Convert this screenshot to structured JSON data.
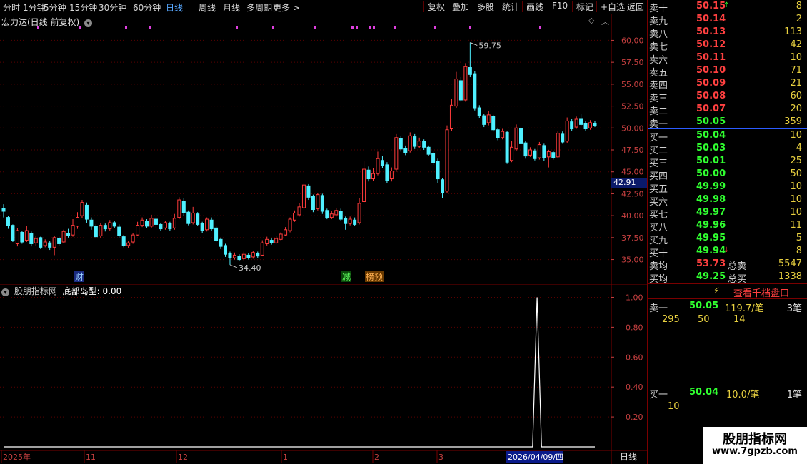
{
  "toolbar": {
    "periods": [
      "分时",
      "1分钟",
      "5分钟",
      "15分钟",
      "30分钟",
      "60分钟",
      "日线",
      "周线",
      "月线",
      "多周期",
      "更多 >"
    ],
    "active_period": "日线",
    "buttons": [
      "复权",
      "叠加",
      "多股",
      "统计",
      "画线",
      "F10",
      "标记",
      "+自选",
      "返回"
    ]
  },
  "main": {
    "stock_title": "宏力达(日线 前复权)",
    "high_label": "59.75",
    "low_label": "34.40",
    "cursor_price": "42.91",
    "markers": {
      "cai": "财",
      "jian": "减",
      "bang": "榜预"
    },
    "y_ticks": [
      "60.00",
      "57.50",
      "55.00",
      "52.50",
      "50.00",
      "47.50",
      "45.00",
      "42.50",
      "40.00",
      "37.50",
      "35.00"
    ]
  },
  "indicator": {
    "name": "股朋指标网",
    "series_label": "底部岛型: 0.00",
    "y_ticks": [
      "1.00",
      "0.80",
      "0.60",
      "0.40",
      "0.20"
    ]
  },
  "xaxis": {
    "labels": [
      "2025年",
      "11",
      "12",
      "1",
      "2",
      "3"
    ],
    "cursor_date": "2026/04/09/四",
    "period_label": "日线"
  },
  "orderbook": {
    "asks": [
      {
        "label": "卖十",
        "price": "50.15",
        "vol": "8"
      },
      {
        "label": "卖九",
        "price": "50.14",
        "vol": "2"
      },
      {
        "label": "卖八",
        "price": "50.13",
        "vol": "113"
      },
      {
        "label": "卖七",
        "price": "50.12",
        "vol": "42"
      },
      {
        "label": "卖六",
        "price": "50.11",
        "vol": "10"
      },
      {
        "label": "卖五",
        "price": "50.10",
        "vol": "71"
      },
      {
        "label": "卖四",
        "price": "50.09",
        "vol": "21"
      },
      {
        "label": "卖三",
        "price": "50.08",
        "vol": "60"
      },
      {
        "label": "卖二",
        "price": "50.07",
        "vol": "20"
      },
      {
        "label": "卖一",
        "price": "50.05",
        "vol": "359"
      }
    ],
    "bids": [
      {
        "label": "买一",
        "price": "50.04",
        "vol": "10"
      },
      {
        "label": "买二",
        "price": "50.03",
        "vol": "4"
      },
      {
        "label": "买三",
        "price": "50.01",
        "vol": "25"
      },
      {
        "label": "买四",
        "price": "50.00",
        "vol": "50"
      },
      {
        "label": "买五",
        "price": "49.99",
        "vol": "10"
      },
      {
        "label": "买六",
        "price": "49.98",
        "vol": "10"
      },
      {
        "label": "买七",
        "price": "49.97",
        "vol": "10"
      },
      {
        "label": "买八",
        "price": "49.96",
        "vol": "11"
      },
      {
        "label": "买九",
        "price": "49.95",
        "vol": "5"
      },
      {
        "label": "买十",
        "price": "49.94",
        "vol": "8"
      }
    ],
    "sell_avg_label": "卖均",
    "sell_avg": "53.73",
    "total_sell_label": "总卖",
    "total_sell": "5547",
    "buy_avg_label": "买均",
    "buy_avg": "49.25",
    "total_buy_label": "总买",
    "total_buy": "1338",
    "depth_link": "查看千档盘口",
    "ask1": {
      "label": "卖一",
      "price": "50.05",
      "qty": "119.7/笔",
      "count": "3笔",
      "d1": "295",
      "d2": "50",
      "d3": "14"
    },
    "bid1": {
      "label": "买一",
      "price": "50.04",
      "qty": "10.0/笔",
      "count": "1笔",
      "d1": "10"
    }
  },
  "watermark": {
    "title": "股朋指标网",
    "url": "www.7gpzb.com"
  },
  "colors": {
    "up": "#ff3b3b",
    "down": "#4ff0ff",
    "grid": "#5a0000",
    "accent": "#58a8ff"
  },
  "chart_data": {
    "type": "candlestick",
    "title": "宏力达(日线 前复权)",
    "ylim": [
      33.5,
      61.5
    ],
    "candles": [
      [
        40.8,
        40.5,
        41.3,
        39.8
      ],
      [
        39.8,
        38.9,
        40.0,
        38.5
      ],
      [
        38.9,
        37.2,
        39.0,
        37.0
      ],
      [
        36.8,
        38.3,
        38.6,
        36.5
      ],
      [
        38.1,
        37.0,
        38.3,
        36.8
      ],
      [
        37.2,
        38.3,
        38.8,
        37.0
      ],
      [
        38.0,
        36.8,
        38.2,
        36.5
      ],
      [
        36.9,
        37.4,
        37.7,
        36.6
      ],
      [
        37.5,
        36.4,
        37.6,
        36.2
      ],
      [
        36.6,
        37.0,
        37.3,
        36.4
      ],
      [
        36.9,
        36.4,
        37.1,
        36.1
      ],
      [
        36.4,
        37.5,
        37.7,
        35.5
      ],
      [
        37.4,
        36.8,
        37.6,
        36.6
      ],
      [
        37.0,
        38.2,
        38.4,
        36.9
      ],
      [
        38.0,
        37.7,
        38.5,
        37.5
      ],
      [
        37.8,
        38.9,
        39.6,
        37.6
      ],
      [
        38.8,
        39.8,
        40.4,
        38.5
      ],
      [
        40.0,
        41.5,
        41.8,
        39.7
      ],
      [
        41.2,
        39.6,
        41.5,
        39.2
      ],
      [
        39.5,
        38.8,
        39.8,
        38.4
      ],
      [
        38.8,
        37.6,
        39.0,
        37.4
      ],
      [
        37.7,
        38.9,
        39.2,
        37.5
      ],
      [
        38.9,
        38.5,
        39.1,
        38.2
      ],
      [
        38.5,
        39.2,
        39.5,
        38.3
      ],
      [
        39.2,
        38.8,
        39.4,
        38.6
      ],
      [
        38.7,
        37.7,
        39.0,
        37.5
      ],
      [
        37.6,
        36.6,
        37.8,
        36.4
      ],
      [
        36.6,
        36.9,
        37.1,
        36.3
      ],
      [
        37.0,
        37.8,
        38.0,
        36.8
      ],
      [
        37.8,
        38.9,
        39.3,
        37.7
      ],
      [
        38.9,
        39.5,
        39.8,
        38.7
      ],
      [
        39.4,
        38.8,
        39.6,
        38.6
      ],
      [
        38.8,
        39.7,
        40.1,
        38.6
      ],
      [
        39.6,
        39.0,
        39.8,
        38.6
      ],
      [
        39.0,
        38.5,
        39.2,
        38.3
      ],
      [
        38.6,
        39.2,
        39.4,
        38.4
      ],
      [
        39.1,
        38.5,
        39.3,
        38.3
      ],
      [
        38.6,
        39.7,
        40.2,
        38.4
      ],
      [
        39.8,
        41.8,
        42.1,
        39.6
      ],
      [
        41.6,
        40.3,
        42.0,
        40.0
      ],
      [
        40.4,
        39.1,
        40.6,
        38.9
      ],
      [
        39.2,
        40.3,
        41.0,
        39.0
      ],
      [
        40.2,
        39.0,
        40.4,
        38.8
      ],
      [
        39.1,
        38.3,
        39.3,
        38.0
      ],
      [
        38.4,
        39.6,
        39.8,
        38.2
      ],
      [
        39.5,
        38.5,
        39.8,
        38.3
      ],
      [
        38.6,
        37.2,
        38.8,
        37.0
      ],
      [
        37.3,
        36.5,
        37.5,
        36.2
      ],
      [
        36.6,
        35.6,
        36.8,
        35.3
      ],
      [
        35.7,
        35.2,
        35.9,
        34.4
      ],
      [
        35.2,
        35.5,
        35.8,
        35.0
      ],
      [
        35.4,
        35.0,
        35.6,
        34.8
      ],
      [
        35.1,
        35.6,
        35.9,
        34.9
      ],
      [
        35.5,
        35.2,
        35.7,
        35.0
      ],
      [
        35.3,
        35.8,
        36.0,
        35.1
      ],
      [
        35.7,
        35.4,
        35.9,
        35.2
      ],
      [
        35.5,
        36.9,
        37.2,
        35.4
      ],
      [
        36.8,
        37.3,
        37.6,
        36.6
      ],
      [
        37.2,
        36.9,
        37.4,
        36.7
      ],
      [
        36.9,
        37.4,
        37.7,
        36.8
      ],
      [
        37.3,
        37.9,
        38.1,
        37.2
      ],
      [
        37.8,
        38.4,
        38.7,
        37.7
      ],
      [
        38.3,
        39.6,
        39.8,
        38.1
      ],
      [
        39.5,
        40.3,
        40.6,
        39.3
      ],
      [
        40.1,
        41.0,
        41.4,
        39.9
      ],
      [
        40.9,
        43.5,
        43.7,
        40.7
      ],
      [
        43.4,
        42.1,
        43.6,
        41.8
      ],
      [
        42.2,
        40.7,
        42.4,
        40.4
      ],
      [
        40.8,
        42.4,
        42.6,
        40.6
      ],
      [
        42.3,
        40.5,
        42.5,
        40.2
      ],
      [
        40.6,
        39.8,
        40.8,
        39.6
      ],
      [
        39.8,
        40.2,
        40.5,
        39.6
      ],
      [
        40.1,
        40.6,
        40.9,
        39.9
      ],
      [
        40.5,
        39.6,
        40.8,
        39.4
      ],
      [
        39.7,
        39.1,
        39.9,
        38.4
      ],
      [
        39.1,
        39.6,
        39.9,
        38.9
      ],
      [
        39.5,
        39.0,
        39.8,
        38.8
      ],
      [
        39.2,
        41.4,
        42.0,
        39.0
      ],
      [
        41.6,
        45.3,
        46.2,
        41.4
      ],
      [
        45.2,
        44.2,
        45.6,
        43.9
      ],
      [
        44.2,
        44.8,
        45.4,
        44.0
      ],
      [
        44.8,
        46.5,
        47.3,
        44.6
      ],
      [
        46.3,
        45.7,
        46.8,
        45.4
      ],
      [
        45.8,
        44.0,
        46.1,
        43.7
      ],
      [
        44.2,
        45.1,
        45.5,
        43.9
      ],
      [
        45.3,
        48.9,
        49.3,
        45.0
      ],
      [
        48.8,
        47.6,
        49.1,
        47.3
      ],
      [
        47.7,
        47.2,
        48.0,
        46.9
      ],
      [
        47.4,
        49.1,
        49.5,
        47.2
      ],
      [
        49.0,
        47.9,
        49.3,
        47.6
      ],
      [
        47.9,
        48.5,
        48.9,
        47.7
      ],
      [
        48.5,
        47.8,
        48.7,
        47.5
      ],
      [
        47.8,
        47.0,
        48.0,
        46.8
      ],
      [
        47.1,
        46.0,
        47.3,
        45.8
      ],
      [
        46.2,
        44.2,
        46.5,
        43.7
      ],
      [
        44.1,
        42.6,
        44.3,
        42.0
      ],
      [
        42.8,
        49.8,
        50.3,
        42.6
      ],
      [
        49.9,
        52.6,
        53.3,
        49.7
      ],
      [
        52.5,
        55.6,
        56.4,
        52.3
      ],
      [
        55.4,
        53.2,
        55.8,
        53.0
      ],
      [
        53.2,
        57.0,
        57.4,
        53.0
      ],
      [
        56.9,
        56.1,
        59.75,
        55.8
      ],
      [
        56.2,
        52.3,
        56.5,
        52.0
      ],
      [
        52.3,
        51.4,
        52.6,
        51.1
      ],
      [
        51.4,
        50.4,
        51.6,
        50.1
      ],
      [
        50.6,
        51.5,
        51.9,
        50.3
      ],
      [
        51.3,
        49.8,
        51.5,
        49.6
      ],
      [
        49.8,
        48.9,
        50.0,
        48.6
      ],
      [
        48.9,
        49.6,
        49.9,
        48.7
      ],
      [
        49.5,
        46.1,
        49.7,
        45.9
      ],
      [
        46.3,
        47.8,
        48.5,
        46.1
      ],
      [
        47.6,
        50.0,
        50.4,
        47.4
      ],
      [
        49.9,
        48.2,
        50.1,
        47.9
      ],
      [
        48.3,
        46.8,
        48.5,
        46.5
      ],
      [
        46.9,
        47.5,
        47.8,
        46.7
      ],
      [
        47.4,
        46.5,
        47.6,
        46.3
      ],
      [
        46.6,
        48.1,
        48.4,
        46.4
      ],
      [
        48.0,
        46.6,
        48.2,
        46.2
      ],
      [
        46.7,
        47.3,
        47.5,
        45.5
      ],
      [
        47.2,
        46.6,
        47.4,
        46.4
      ],
      [
        46.7,
        49.4,
        49.6,
        46.6
      ],
      [
        49.3,
        48.4,
        49.6,
        48.2
      ],
      [
        48.5,
        50.8,
        51.2,
        48.3
      ],
      [
        50.7,
        49.9,
        51.0,
        49.7
      ],
      [
        50.1,
        51.0,
        51.3,
        49.9
      ],
      [
        51.0,
        50.4,
        51.6,
        50.2
      ],
      [
        50.5,
        49.9,
        50.8,
        49.7
      ],
      [
        50.0,
        50.6,
        50.9,
        49.8
      ],
      [
        50.5,
        50.3,
        50.8,
        50.1
      ]
    ],
    "indicator_series": [
      0,
      0,
      0,
      0,
      0,
      0,
      0,
      0,
      0,
      0,
      0,
      0,
      0,
      0,
      0,
      0,
      0,
      0,
      0,
      0,
      0,
      0,
      0,
      0,
      0,
      0,
      0,
      0,
      0,
      0,
      0,
      0,
      0,
      0,
      0,
      0,
      0,
      0,
      0,
      0,
      0,
      0,
      0,
      0,
      0,
      0,
      0,
      0,
      0,
      0,
      0,
      0,
      0,
      0,
      0,
      0,
      0,
      0,
      0,
      0,
      0,
      0,
      0,
      0,
      0,
      0,
      0,
      0,
      0,
      0,
      0,
      0,
      0,
      0,
      0,
      0,
      0,
      0,
      0,
      0,
      0,
      0,
      0,
      0,
      0,
      0,
      0,
      0,
      0,
      0,
      0,
      0,
      0,
      0,
      0,
      0,
      0,
      0,
      0,
      0,
      0,
      0,
      0,
      0,
      0,
      0,
      0,
      0,
      0,
      0,
      0,
      0,
      0,
      0,
      0,
      0,
      0,
      0,
      0,
      0,
      1,
      0,
      0,
      0,
      0,
      0,
      0,
      0,
      0,
      0,
      0,
      0,
      0,
      0
    ],
    "indicator_ylim": [
      0,
      1.05
    ]
  }
}
